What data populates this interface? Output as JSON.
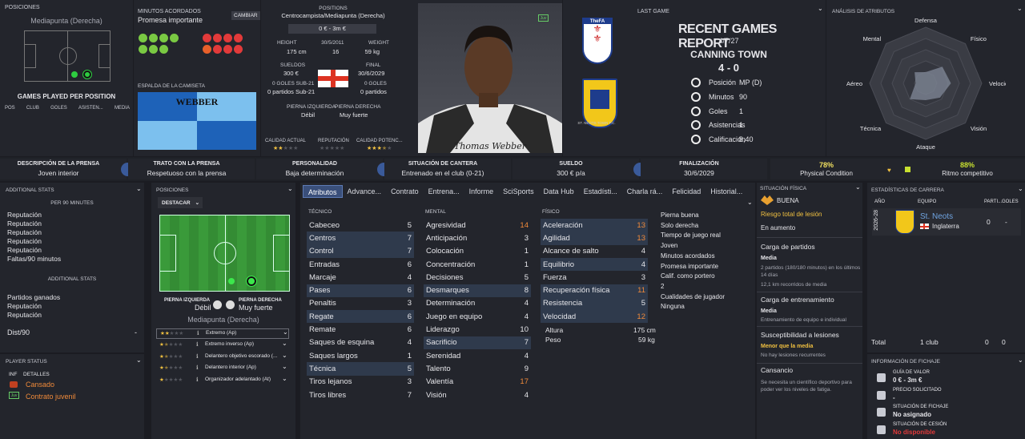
{
  "top": {
    "positions_title": "POSICIONES",
    "position_name": "Mediapunta (Derecha)",
    "games_title": "GAMES PLAYED PER POSITION",
    "games_cols": [
      "POS",
      "CLUB",
      "GOLES",
      "ASISTEN...",
      "MEDIA"
    ],
    "minutes_title": "MINUTOS ACORDADOS",
    "minutes_value": "Promesa importante",
    "cambiar": "CAMBIAR",
    "shirt_title": "ESPALDA DE LA CAMISETA",
    "shirt_name": "WEBBER",
    "positions_label": "POSITIONS",
    "positions_value": "Centrocampista/Mediapunta (Derecha)",
    "value_range": "0 € - 3m €",
    "height_lbl": "HEIGHT",
    "height_val": "175 cm",
    "dob_lbl": "30/5/2011",
    "age_val": "16",
    "weight_lbl": "WEIGHT",
    "weight_val": "59 kg",
    "wages_lbl": "SUELDOS",
    "wages_val": "300 €",
    "end_lbl": "FINAL",
    "end_val": "30/6/2029",
    "u21g_lbl": "0 GOLES SUB-21",
    "u21p_val": "0 partidos Sub-21",
    "goals_lbl": "0 GOLES",
    "apps_val": "0 partidos",
    "left_foot_lbl": "PIERNA IZQUIERDA",
    "left_foot_val": "Débil",
    "right_foot_lbl": "PIERNA DERECHA",
    "right_foot_val": "Muy fuerte",
    "ca_lbl": "CALIDAD ACTUAL",
    "rep_lbl": "REPUTACIÓN",
    "pa_lbl": "CALIDAD POTENC...",
    "ca_stars": 2,
    "rep_stars": 0,
    "pa_stars": 3.5,
    "juv_badge": "Juv",
    "player_name": "Thomas Webber",
    "last_game_lbl": "LAST GAME",
    "report_title": "RECENT GAMES REPORT",
    "report_date": "4/7/27",
    "report_opp": "CANNING TOWN",
    "report_score": "4 - 0",
    "report_rows": [
      {
        "k": "Posición",
        "v": "MP (D)"
      },
      {
        "k": "Minutos",
        "v": "90"
      },
      {
        "k": "Goles",
        "v": "1"
      },
      {
        "k": "Asistencias",
        "v": "1"
      },
      {
        "k": "Calificación",
        "v": "8,40"
      }
    ],
    "crest_top": "TheFA",
    "crest_bottom": "ST. NEOTS TOWN F.C.",
    "radar_title": "ANÁLISIS DE ATRIBUTOS",
    "radar_labels": [
      "Defensa",
      "Físico",
      "Velocidad",
      "Visión",
      "Ataque",
      "Técnica",
      "Aéreo",
      "Mental"
    ],
    "radar_values": [
      0.2,
      0.42,
      0.45,
      0.36,
      0.3,
      0.4,
      0.18,
      0.28
    ]
  },
  "strip": [
    {
      "t": "DESCRIPCIÓN DE LA PRENSA",
      "v": "Joven interior"
    },
    {
      "t": "TRATO CON LA PRENSA",
      "v": "Respetuoso con la prensa"
    },
    {
      "t": "PERSONALIDAD",
      "v": "Baja determinación"
    },
    {
      "t": "SITUACIÓN DE CANTERA",
      "v": "Entrenado en el club (0-21)"
    },
    {
      "t": "SUELDO",
      "v": "300 € p/a"
    },
    {
      "t": "FINALIZACIÓN",
      "v": "30/6/2029"
    }
  ],
  "condition": {
    "pct": "78%",
    "lbl": "Physical Condition",
    "level": 0.78
  },
  "sharp": {
    "pct": "88%",
    "lbl": "Ritmo competitivo",
    "level": 0.88
  },
  "add_stats": {
    "title": "ADDITIONAL STATS",
    "sub": "PER 90 MINUTES",
    "items": [
      "Reputación",
      "Reputación",
      "Reputación",
      "Reputación",
      "Reputación",
      "Faltas/90 minutos"
    ],
    "sub2": "ADDITIONAL STATS",
    "items2": [
      "Partidos ganados",
      "Reputación",
      "Reputación"
    ],
    "dist": "Dist/90",
    "dist_val": "-"
  },
  "player_status": {
    "title": "PLAYER STATUS",
    "c1": "INF",
    "c2": "DETALLES",
    "items": [
      "Cansado",
      "Contrato juvenil"
    ],
    "badge": "Juv"
  },
  "pos_panel": {
    "title": "POSICIONES",
    "select": "DESTACAR",
    "lf_lbl": "PIERNA IZQUIERDA",
    "lf_val": "Débil",
    "rf_lbl": "PIERNA DERECHA",
    "rf_val": "Muy fuerte",
    "pos_name": "Mediapunta (Derecha)",
    "roles": [
      {
        "n": "Extremo (Ap)",
        "s": 2
      },
      {
        "n": "Extremo inverso (Ap)",
        "s": 1.5
      },
      {
        "n": "Delantero objetivo escorado (...",
        "s": 1.5
      },
      {
        "n": "Delantero interior (Ap)",
        "s": 1.5
      },
      {
        "n": "Organizador adelantado (At)",
        "s": 1
      }
    ]
  },
  "tabs": [
    "Atributos",
    "Advance...",
    "Contrato",
    "Entrena...",
    "Informe",
    "SciSports",
    "Data Hub",
    "Estadísti...",
    "Charla rá...",
    "Felicidad",
    "Historial..."
  ],
  "attrs": {
    "tec_title": "TÉCNICO",
    "men_title": "MENTAL",
    "fis_title": "FÍSICO",
    "tec": [
      [
        "Cabeceo",
        "5",
        0
      ],
      [
        "Centros",
        "7",
        1
      ],
      [
        "Control",
        "7",
        1
      ],
      [
        "Entradas",
        "6",
        0
      ],
      [
        "Marcaje",
        "4",
        0
      ],
      [
        "Pases",
        "6",
        1
      ],
      [
        "Penaltis",
        "3",
        0
      ],
      [
        "Regate",
        "6",
        1
      ],
      [
        "Remate",
        "6",
        0
      ],
      [
        "Saques de esquina",
        "4",
        0
      ],
      [
        "Saques largos",
        "1",
        0
      ],
      [
        "Técnica",
        "5",
        1
      ],
      [
        "Tiros lejanos",
        "3",
        0
      ],
      [
        "Tiros libres",
        "7",
        0
      ]
    ],
    "men": [
      [
        "Agresividad",
        "14",
        0
      ],
      [
        "Anticipación",
        "3",
        0
      ],
      [
        "Colocación",
        "1",
        0
      ],
      [
        "Concentración",
        "1",
        0
      ],
      [
        "Decisiones",
        "5",
        0
      ],
      [
        "Desmarques",
        "8",
        1
      ],
      [
        "Determinación",
        "4",
        0
      ],
      [
        "Juego en equipo",
        "4",
        0
      ],
      [
        "Liderazgo",
        "10",
        0
      ],
      [
        "Sacrificio",
        "7",
        1
      ],
      [
        "Serenidad",
        "4",
        0
      ],
      [
        "Talento",
        "9",
        0
      ],
      [
        "Valentía",
        "17",
        0
      ],
      [
        "Visión",
        "4",
        0
      ]
    ],
    "fis": [
      [
        "Aceleración",
        "13",
        1
      ],
      [
        "Agilidad",
        "13",
        1
      ],
      [
        "Alcance de salto",
        "4",
        0
      ],
      [
        "Equilibrio",
        "4",
        1
      ],
      [
        "Fuerza",
        "3",
        0
      ],
      [
        "Recuperación física",
        "11",
        1
      ],
      [
        "Resistencia",
        "5",
        1
      ],
      [
        "Velocidad",
        "12",
        1
      ]
    ],
    "alt_lbl": "Altura",
    "alt_val": "175 cm",
    "peso_lbl": "Peso",
    "peso_val": "59 kg",
    "notes": [
      "Pierna buena",
      "Solo derecha",
      "Tiempo de juego real",
      "Joven",
      "Minutos acordados",
      "Promesa importante",
      "Calif. como portero",
      "2",
      "Cualidades de jugador",
      "Ninguna"
    ]
  },
  "phys": {
    "title": "SITUACIÓN FÍSICA",
    "state": "BUENA",
    "risk": "Riesgo total de lesión",
    "trend": "En aumento",
    "load_title": "Carga de partidos",
    "load_lvl": "Media",
    "load_txt": "2 partidos (180/180 minutos) en los últimos 14 días",
    "load_txt2": "12,1 km recorridos de media",
    "tr_title": "Carga de entrenamiento",
    "tr_lvl": "Media",
    "tr_txt": "Entrenamiento de equipo e individual",
    "inj_title": "Susceptibilidad a lesiones",
    "inj_lvl": "Menor que la media",
    "inj_txt": "No hay lesiones recurrentes",
    "fat_title": "Cansancio",
    "fat_txt": "Se necesita un científico deportivo para poder ver los niveles de fatiga."
  },
  "career": {
    "title": "ESTADÍSTICAS DE CARRERA",
    "h": [
      "AÑO",
      "EQUIPO",
      "PARTI...",
      "GOLES"
    ],
    "year": "2026-28",
    "team": "St. Neots",
    "country": "Inglaterra",
    "apps": "0",
    "goals": "-",
    "total_lbl": "Total",
    "total_clubs": "1 club",
    "t_apps": "0",
    "t_goals": "0"
  },
  "transfer": {
    "title": "INFORMACIÓN DE FICHAJE",
    "items": [
      {
        "l": "GUÍA DE VALOR",
        "v": "0 € - 3m €",
        "red": false
      },
      {
        "l": "PRECIO SOLICITADO",
        "v": "-",
        "red": false
      },
      {
        "l": "SITUACIÓN DE FICHAJE",
        "v": "No asignado",
        "red": false
      },
      {
        "l": "SITUACIÓN DE CESIÓN",
        "v": "No disponible",
        "red": true
      }
    ]
  },
  "colors": {
    "accent": "#3a4f7a",
    "orange": "#f08a3a",
    "yellow": "#f0c040",
    "green": "#7ac943",
    "red": "#e23a3a"
  }
}
